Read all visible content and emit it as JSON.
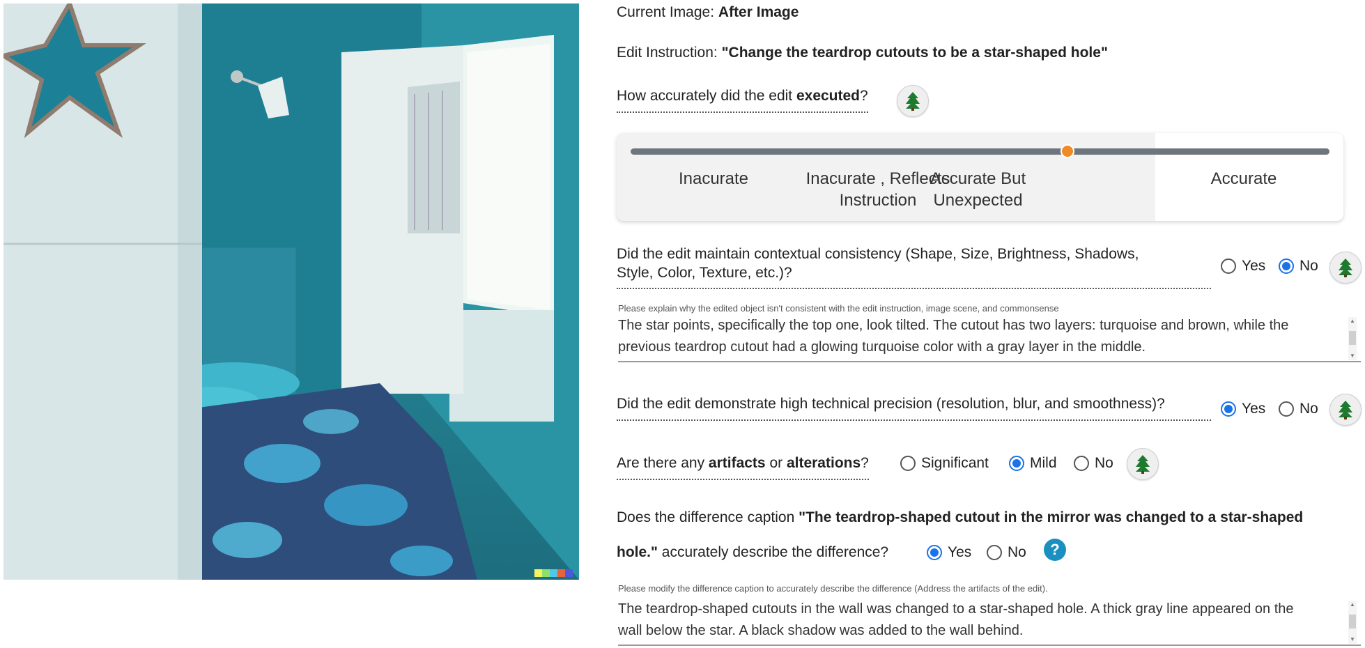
{
  "current_image": {
    "label": "Current Image:",
    "value": "After Image"
  },
  "edit_instruction": {
    "label": "Edit Instruction:",
    "value": "\"Change the teardrop cutouts to be a star-shaped hole\""
  },
  "q_accuracy": {
    "pre": "How accurately did the edit ",
    "bold": "executed",
    "post": "?"
  },
  "slider": {
    "options": [
      "Inacurate",
      "Inacurate , Reflects Instruction",
      "Accurate But Unexpected",
      "Accurate"
    ],
    "selected_index": 2,
    "value_fraction": 0.625
  },
  "q_consistency": {
    "line1": "Did the edit maintain contextual consistency (Shape, Size, Brightness, Shadows,",
    "line2": "Style, Color, Texture, etc.)?",
    "options": [
      "Yes",
      "No"
    ],
    "selected": "No"
  },
  "consistency_explain": {
    "hint": "Please explain why the edited object isn't consistent with the edit instruction, image scene, and commonsense",
    "line1": "The star points, specifically the top one, look tilted. The cutout has two layers: turquoise and brown, while the",
    "line2": "previous teardrop cutout had a glowing turquoise color with a gray layer in the middle."
  },
  "q_precision": {
    "text": "Did the edit demonstrate high technical precision (resolution, blur, and smoothness)?",
    "options": [
      "Yes",
      "No"
    ],
    "selected": "Yes"
  },
  "q_artifacts": {
    "pre": "Are there any ",
    "b1": "artifacts",
    "mid": " or ",
    "b2": "alterations",
    "post": "?",
    "options": [
      "Significant",
      "Mild",
      "No"
    ],
    "selected": "Mild"
  },
  "q_caption": {
    "pre": "Does the difference caption ",
    "bold1": "\"The teardrop-shaped cutout in the mirror was changed to a star-shaped",
    "bold2": "hole.\"",
    "post": " accurately describe the difference?",
    "options": [
      "Yes",
      "No"
    ],
    "selected": "Yes",
    "help_glyph": "?"
  },
  "caption_modify": {
    "hint": "Please modify the difference caption to accurately describe the difference (Address the artifacts of the edit).",
    "line1": "The teardrop-shaped cutouts in the wall was changed to a star-shaped hole. A thick gray line appeared on the",
    "line2": "wall below the star. A black shadow was added to the wall behind."
  },
  "icons": {
    "tree": "tree-icon",
    "help": "help-icon"
  },
  "colors": {
    "accent": "#1a73e8",
    "slider_thumb": "#f08a24",
    "tree_green": "#1e7a2e",
    "help_blue": "#1b8fc0"
  }
}
